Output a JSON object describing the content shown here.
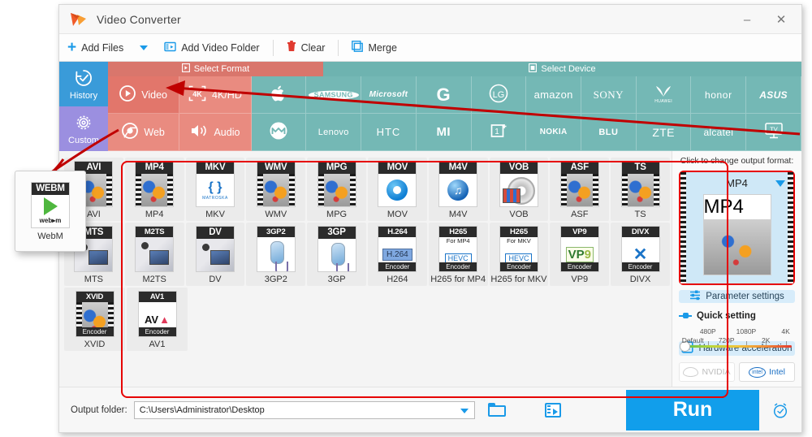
{
  "window": {
    "title": "Video Converter",
    "logo_icon": "app-logo-icon",
    "minimize_label": "–",
    "close_label": "✕"
  },
  "toolbar": {
    "add_files": "Add Files",
    "add_files_caret": "dropdown-caret-icon",
    "add_video_folder": "Add Video Folder",
    "clear": "Clear",
    "merge": "Merge"
  },
  "sidebar": {
    "items": [
      {
        "label": "History",
        "icon": "history-icon"
      },
      {
        "label": "Custom",
        "icon": "gear-icon"
      }
    ]
  },
  "category": {
    "format_header": "Select Format",
    "device_header": "Select Device",
    "format_tiles": [
      {
        "label": "Video",
        "icon": "play-circle-icon",
        "active": true
      },
      {
        "label": "4K/HD",
        "icon": "4k-icon",
        "active": false
      },
      {
        "label": "Web",
        "icon": "chrome-icon",
        "active": false
      },
      {
        "label": "Audio",
        "icon": "speaker-icon",
        "active": false
      }
    ],
    "device_row_1": [
      "Apple",
      "SAMSUNG",
      "Microsoft",
      "G",
      "LG",
      "amazon",
      "SONY",
      "HUAWEI",
      "honor",
      "ASUS"
    ],
    "device_row_2": [
      "Motorola",
      "Lenovo",
      "HTC",
      "MI",
      "1+",
      "NOKIA",
      "BLU",
      "ZTE",
      "alcatel",
      "TV"
    ]
  },
  "formats": {
    "rows": [
      [
        {
          "label": "AVI",
          "tag": "AVI",
          "thumb": "balloon"
        },
        {
          "label": "MP4",
          "tag": "MP4",
          "thumb": "balloon"
        },
        {
          "label": "MKV",
          "tag": "MKV",
          "thumb": "matroska",
          "sub": "MATROSKA"
        },
        {
          "label": "WMV",
          "tag": "WMV",
          "thumb": "balloon"
        },
        {
          "label": "MPG",
          "tag": "MPG",
          "thumb": "balloon"
        },
        {
          "label": "MOV",
          "tag": "MOV",
          "thumb": "quicktime"
        },
        {
          "label": "M4V",
          "tag": "M4V",
          "thumb": "itunes"
        },
        {
          "label": "VOB",
          "tag": "VOB",
          "thumb": "disc"
        },
        {
          "label": "ASF",
          "tag": "ASF",
          "thumb": "balloon"
        },
        {
          "label": "TS",
          "tag": "TS",
          "thumb": "balloon"
        }
      ],
      [
        {
          "label": "MTS",
          "tag": "MTS",
          "thumb": "camcorder"
        },
        {
          "label": "M2TS",
          "tag": "M2TS",
          "thumb": "camcorder"
        },
        {
          "label": "DV",
          "tag": "DV",
          "thumb": "camcorder"
        },
        {
          "label": "3GP2",
          "tag": "3GP2",
          "thumb": "phone"
        },
        {
          "label": "3GP",
          "tag": "3GP",
          "thumb": "phone"
        },
        {
          "label": "H264",
          "tag": "H.264",
          "thumb": "h264",
          "encoder": "Encoder"
        },
        {
          "label": "H265 for MP4",
          "tag": "H265",
          "sub": "For MP4",
          "thumb": "hevc",
          "encoder": "Encoder"
        },
        {
          "label": "H265 for MKV",
          "tag": "H265",
          "sub": "For MKV",
          "thumb": "hevc",
          "encoder": "Encoder"
        },
        {
          "label": "VP9",
          "tag": "VP9",
          "thumb": "vp9",
          "encoder": "Encoder"
        },
        {
          "label": "DIVX",
          "tag": "DIVX",
          "thumb": "divx",
          "encoder": "Encoder"
        }
      ],
      [
        {
          "label": "XVID",
          "tag": "XVID",
          "thumb": "balloon",
          "encoder": "Encoder"
        },
        {
          "label": "AV1",
          "tag": "AV1",
          "thumb": "av1",
          "encoder": "Encoder"
        }
      ]
    ]
  },
  "webm_popup": {
    "label": "WebM",
    "tag": "WEBM",
    "wordmark": "web",
    "wordmark_suffix": "m"
  },
  "right_panel": {
    "hint": "Click to change output format:",
    "output_format": "MP4",
    "output_format_tag": "MP4",
    "parameter_settings": "Parameter settings",
    "quick_setting": "Quick setting",
    "quality_top": [
      "480P",
      "1080P",
      "4K"
    ],
    "quality_bottom": [
      "Default",
      "720P",
      "2K"
    ],
    "hardware_acceleration": "Hardware acceleration",
    "nvidia": "NVIDIA",
    "intel": "Intel",
    "intel_mark": "intel"
  },
  "bottom": {
    "output_folder_label": "Output folder:",
    "output_folder_value": "C:\\Users\\Administrator\\Desktop",
    "open_folder_icon": "folder-icon",
    "media_folder_icon": "film-folder-icon",
    "run_label": "Run",
    "alarm_icon": "alarm-clock-icon"
  },
  "colors": {
    "accent_blue": "#119eeb",
    "format_red": "#e98b80",
    "format_red_active": "#e2766b",
    "device_teal": "#74b8b5",
    "history_blue": "#3a9bd9",
    "custom_purple": "#9b8fe0",
    "annotation_red": "#e60000"
  }
}
